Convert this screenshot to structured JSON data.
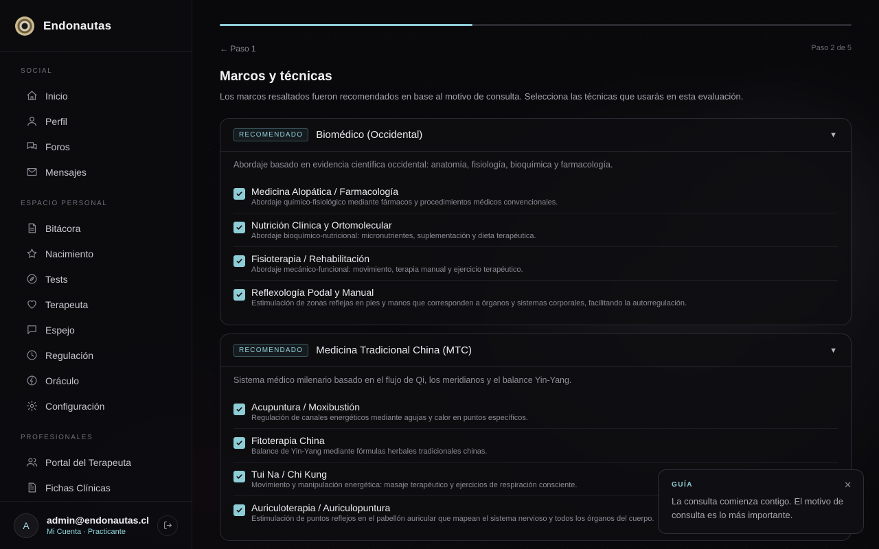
{
  "brand": {
    "name": "Endonautas"
  },
  "sidebar": {
    "sections": [
      {
        "title": "SOCIAL",
        "items": [
          {
            "label": "Inicio",
            "icon": "home-icon"
          },
          {
            "label": "Perfil",
            "icon": "user-icon"
          },
          {
            "label": "Foros",
            "icon": "forum-icon"
          },
          {
            "label": "Mensajes",
            "icon": "mail-icon"
          }
        ]
      },
      {
        "title": "ESPACIO PERSONAL",
        "items": [
          {
            "label": "Bitácora",
            "icon": "document-icon"
          },
          {
            "label": "Nacimiento",
            "icon": "star-icon"
          },
          {
            "label": "Tests",
            "icon": "compass-icon"
          },
          {
            "label": "Terapeuta",
            "icon": "heart-icon"
          },
          {
            "label": "Espejo",
            "icon": "chat-icon"
          },
          {
            "label": "Regulación",
            "icon": "clock-icon"
          },
          {
            "label": "Oráculo",
            "icon": "oracle-icon"
          },
          {
            "label": "Configuración",
            "icon": "gear-icon"
          }
        ]
      },
      {
        "title": "PROFESIONALES",
        "items": [
          {
            "label": "Portal del Terapeuta",
            "icon": "users-icon"
          },
          {
            "label": "Fichas Clínicas",
            "icon": "file-icon"
          }
        ]
      }
    ]
  },
  "user": {
    "initial": "A",
    "email": "admin@endonautas.cl",
    "subtitle": "Mi Cuenta · Practicante"
  },
  "wizard": {
    "progress": 0.4,
    "back_label": "← Paso 1",
    "step_label": "Paso 2 de 5",
    "title": "Marcos y técnicas",
    "description": "Los marcos resaltados fueron recomendados en base al motivo de consulta. Selecciona las técnicas que usarás en esta evaluación."
  },
  "frameworks": [
    {
      "badge": "RECOMENDADO",
      "title": "Biomédico (Occidental)",
      "description": "Abordaje basado en evidencia científica occidental: anatomía, fisiología, bioquímica y farmacología.",
      "techniques": [
        {
          "name": "Medicina Alopática / Farmacología",
          "desc": "Abordaje químico-fisiológico mediante fármacos y procedimientos médicos convencionales.",
          "checked": true
        },
        {
          "name": "Nutrición Clínica y Ortomolecular",
          "desc": "Abordaje bioquímico-nutricional: micronutrientes, suplementación y dieta terapéutica.",
          "checked": true
        },
        {
          "name": "Fisioterapia / Rehabilitación",
          "desc": "Abordaje mecánico-funcional: movimiento, terapia manual y ejercicio terapéutico.",
          "checked": true
        },
        {
          "name": "Reflexología Podal y Manual",
          "desc": "Estimulación de zonas reflejas en pies y manos que corresponden a órganos y sistemas corporales, facilitando la autorregulación.",
          "checked": true
        }
      ]
    },
    {
      "badge": "RECOMENDADO",
      "title": "Medicina Tradicional China (MTC)",
      "description": "Sistema médico milenario basado en el flujo de Qi, los meridianos y el balance Yin-Yang.",
      "techniques": [
        {
          "name": "Acupuntura / Moxibustión",
          "desc": "Regulación de canales energéticos mediante agujas y calor en puntos específicos.",
          "checked": true
        },
        {
          "name": "Fitoterapia China",
          "desc": "Balance de Yin-Yang mediante fórmulas herbales tradicionales chinas.",
          "checked": true
        },
        {
          "name": "Tui Na / Chi Kung",
          "desc": "Movimiento y manipulación energética: masaje terapéutico y ejercicios de respiración consciente.",
          "checked": true
        },
        {
          "name": "Auriculoterapia / Auriculopuntura",
          "desc": "Estimulación de puntos reflejos en el pabellón auricular que mapean el sistema nervioso y todos los órganos del cuerpo.",
          "checked": true
        }
      ]
    }
  ],
  "guide": {
    "title": "GUÍA",
    "text": "La consulta comienza contigo. El motivo de consulta es lo más importante."
  },
  "colors": {
    "accent": "#8fcdd6",
    "background": "#0a0a0d"
  }
}
